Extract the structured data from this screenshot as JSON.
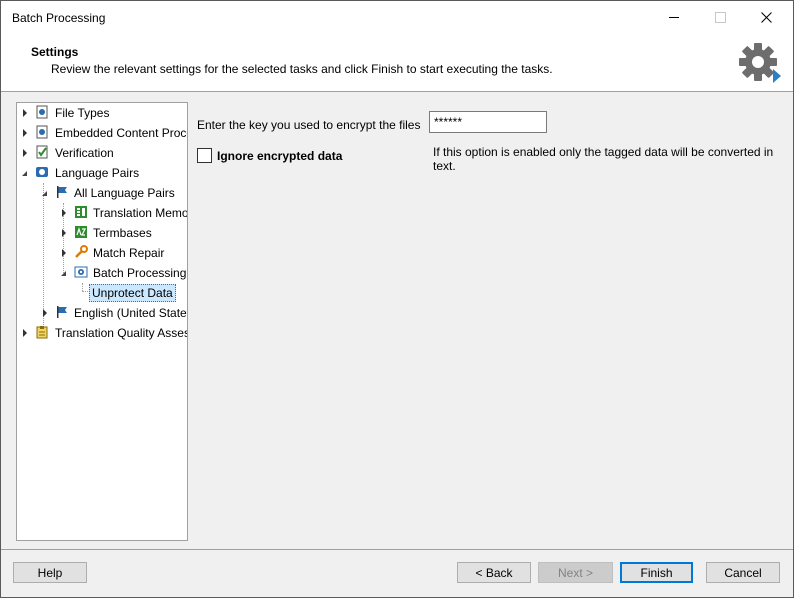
{
  "window": {
    "title": "Batch Processing"
  },
  "header": {
    "title": "Settings",
    "description": "Review the relevant settings for the selected tasks and click Finish to start executing the tasks.",
    "icon": "gear-icon"
  },
  "tree": {
    "items": [
      {
        "label": "File Types",
        "icon": "file-types-icon",
        "expanded": false
      },
      {
        "label": "Embedded Content Proce",
        "icon": "embedded-content-icon",
        "expanded": false
      },
      {
        "label": "Verification",
        "icon": "verification-icon",
        "expanded": false
      },
      {
        "label": "Language Pairs",
        "icon": "language-pairs-icon",
        "expanded": true
      },
      {
        "label": "All Language Pairs",
        "icon": "flag-icon",
        "expanded": true
      },
      {
        "label": "Translation Memo",
        "icon": "translation-memory-icon",
        "expanded": false
      },
      {
        "label": "Termbases",
        "icon": "termbase-icon",
        "expanded": false
      },
      {
        "label": "Match Repair",
        "icon": "wrench-icon",
        "expanded": false
      },
      {
        "label": "Batch Processing",
        "icon": "batch-processing-icon",
        "expanded": true
      },
      {
        "label": "Unprotect Data",
        "icon": "",
        "selected": true
      },
      {
        "label": "English (United States",
        "icon": "flag-icon",
        "expanded": false
      },
      {
        "label": "Translation Quality Assess",
        "icon": "clipboard-icon",
        "expanded": false
      }
    ]
  },
  "form": {
    "key_label": "Enter the key you used to encrypt the files",
    "key_value": "******",
    "ignore_label": "Ignore encrypted data",
    "ignore_checked": false,
    "ignore_help": "If this option is enabled only the tagged data will be converted in text."
  },
  "buttons": {
    "help": "Help",
    "back": "< Back",
    "next": "Next >",
    "finish": "Finish",
    "cancel": "Cancel"
  },
  "colors": {
    "accent": "#0078d7",
    "selection": "#cce8ff"
  }
}
